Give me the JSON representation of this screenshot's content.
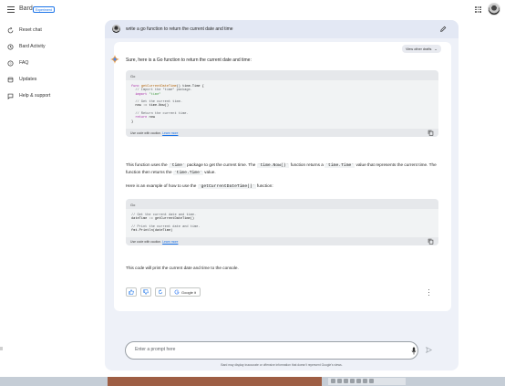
{
  "app": {
    "name": "Bard",
    "badge": "Experiment"
  },
  "sidebar": {
    "items": [
      {
        "label": "Reset chat",
        "icon": "reset-icon"
      },
      {
        "label": "Bard Activity",
        "icon": "history-icon"
      },
      {
        "label": "FAQ",
        "icon": "help-circle-icon"
      },
      {
        "label": "Updates",
        "icon": "updates-icon"
      },
      {
        "label": "Help & support",
        "icon": "feedback-icon"
      }
    ]
  },
  "conversation": {
    "prompt": "write a go function to return the current date and time",
    "drafts_label": "View other drafts",
    "intro": "Sure, here is a Go function to return the current date and time:",
    "code1": {
      "language": "Go",
      "caution": "Use code with caution.",
      "learn_more": "Learn more"
    },
    "para1_a": "This function uses the ",
    "para1_code1": "`time`",
    "para1_b": " package to get the current time. The ",
    "para1_code2": "`time.Now()`",
    "para1_c": " function returns a ",
    "para1_code3": "`time.Time`",
    "para1_d": " value that represents the current time. The function then returns the ",
    "para1_code4": "`time.Time`",
    "para1_e": " value.",
    "para2_a": "Here is an example of how to use the ",
    "para2_code": "`getCurrentDateTime()`",
    "para2_b": " function:",
    "code2": {
      "language": "Go",
      "caution": "Use code with caution.",
      "learn_more": "Learn more"
    },
    "para3": "This code will print the current date and time to the console.",
    "google_it": "Google it"
  },
  "input": {
    "placeholder": "Enter a prompt here",
    "disclaimer": "Bard may display inaccurate or offensive information that doesn't represent Google's views."
  },
  "colors": {
    "accent": "#1a73e8",
    "panel_bg": "#eef1f8",
    "code_bg": "#f1f3f4"
  }
}
